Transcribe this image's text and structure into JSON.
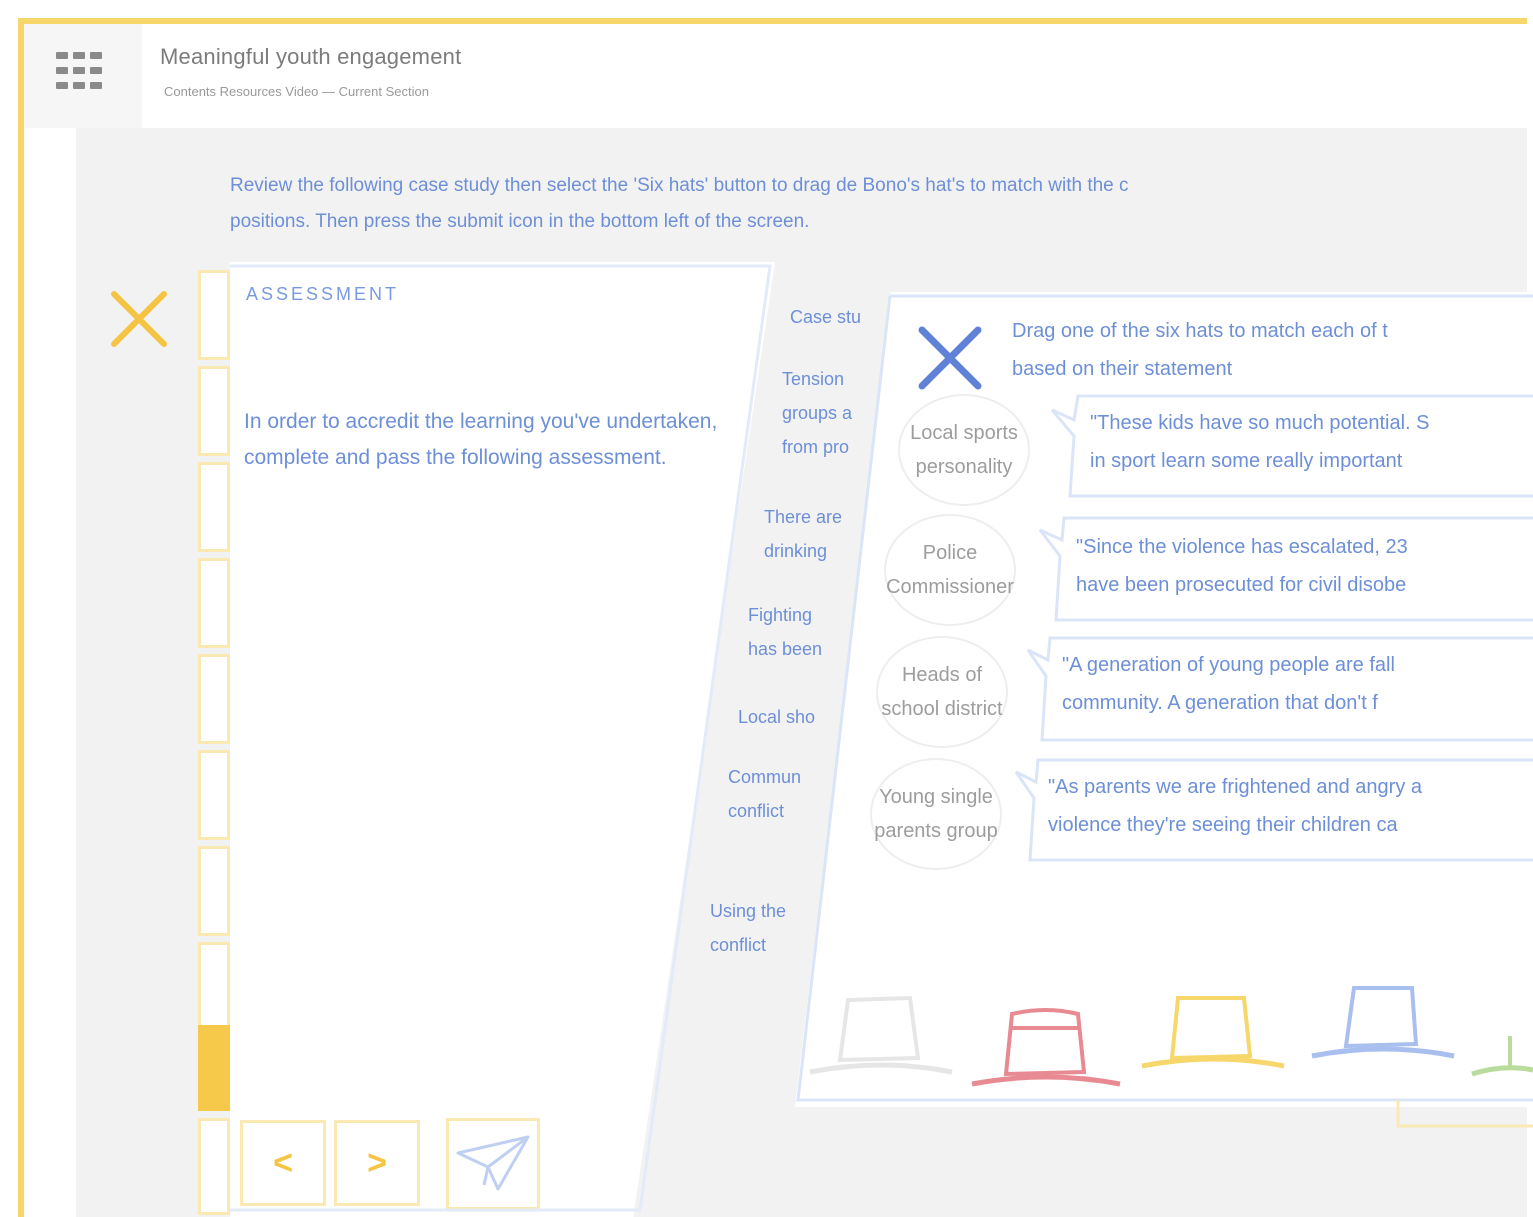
{
  "header": {
    "title": "Meaningful youth engagement",
    "subtitle": "Contents Resources Video  —  Current Section"
  },
  "instructions": "Review the following case study then select the 'Six hats' button to drag de Bono's hat's to match with the c\npositions. Then press the submit icon in the bottom left of the screen.",
  "assessment": {
    "label": "ASSESSMENT",
    "body": "In order to accredit the learning you've undertaken, complete and pass the following assessment."
  },
  "case_study": {
    "items": [
      "Case stu",
      "Tension\ngroups a\nfrom pro",
      "There are\ndrinking",
      "Fighting\nhas been",
      "Local sho",
      "Commun\nconflict",
      "Using the\nconflict"
    ]
  },
  "modal": {
    "prompt": "Drag one of the six hats to match each of t\nbased on their statement",
    "rows": [
      {
        "persona": "Local sports personality",
        "quote": "\"These kids have so much potential. S\nin sport learn some really important"
      },
      {
        "persona": "Police Commissioner",
        "quote": "\"Since the violence has escalated, 23\nhave been prosecuted for civil disobe"
      },
      {
        "persona": "Heads of school district",
        "quote": "\"A generation of young people are fall\ncommunity. A generation that don't f"
      },
      {
        "persona": "Young single parents group",
        "quote": "\"As parents we are frightened and angry a\nviolence they're seeing their children ca"
      }
    ]
  },
  "hats": [
    {
      "name": "white-hat",
      "color": "#e8e8e8"
    },
    {
      "name": "red-hat",
      "color": "#e88a92"
    },
    {
      "name": "yellow-hat",
      "color": "#f7d66b"
    },
    {
      "name": "blue-hat",
      "color": "#a9bff0"
    },
    {
      "name": "green-hat",
      "color": "#b9dc9c"
    }
  ],
  "colors": {
    "accent_yellow": "#f7c94b",
    "text_blue": "#6d8fd8",
    "outline_blue": "#dbe5f8"
  }
}
